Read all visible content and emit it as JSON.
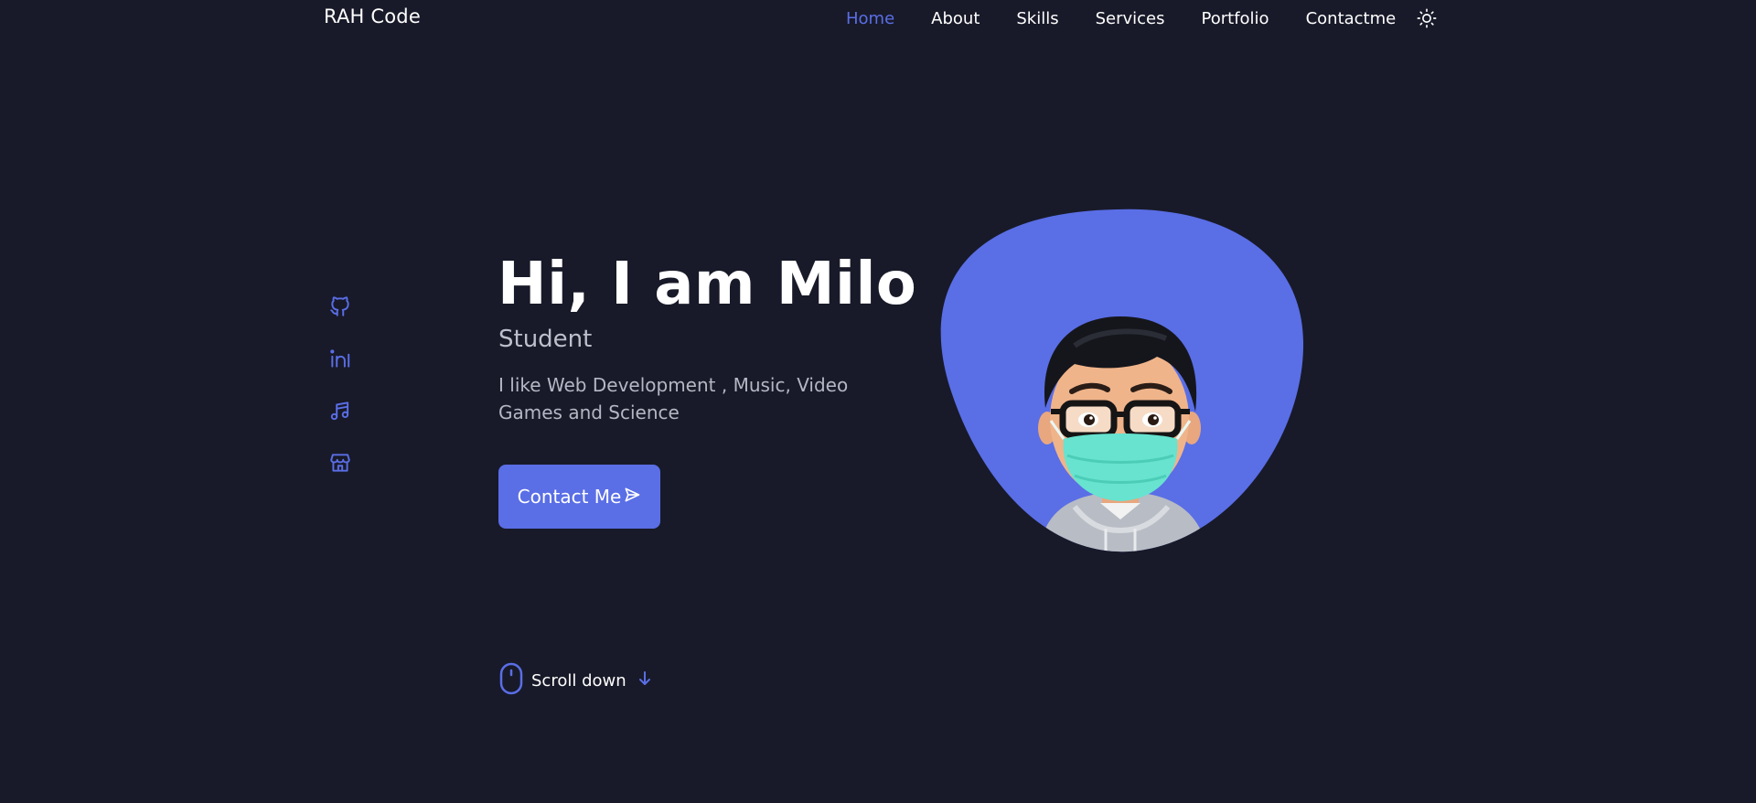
{
  "header": {
    "logo": "RAH Code",
    "nav": [
      "Home",
      "About",
      "Skills",
      "Services",
      "Portfolio",
      "Contactme"
    ],
    "active_nav": "Home",
    "theme_icon": "sun-icon"
  },
  "social": {
    "icons": [
      "github-icon",
      "linkedin-icon",
      "music-icon",
      "store-icon"
    ]
  },
  "hero": {
    "title": "Hi, I am Milo",
    "subtitle": "Student",
    "description": "I like Web Development , Music, Video Games and Science",
    "button_label": "Contact Me",
    "button_icon": "send-icon",
    "image": "avatar-with-mask"
  },
  "scroll": {
    "label": "Scroll down",
    "mouse_icon": "mouse-icon",
    "arrow_icon": "arrow-down-icon"
  },
  "colors": {
    "background": "#181a29",
    "accent": "#5a6ee6",
    "text": "#ffffff",
    "muted": "#b5b7c4"
  }
}
